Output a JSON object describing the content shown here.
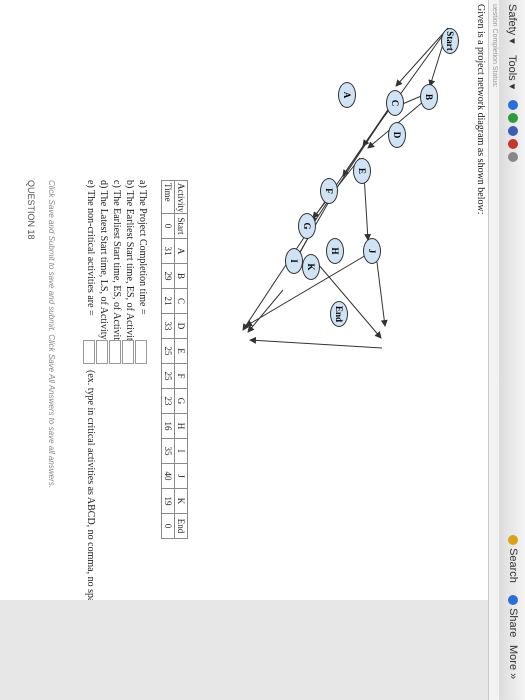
{
  "toolbar": {
    "safety": "Safety ▾",
    "tools": "Tools ▾",
    "search": "Search",
    "share": "Share",
    "more": "More »"
  },
  "status_strip": "uestion Completion Status:",
  "intro": "Given is a project network diagram as shown below:",
  "nodes": [
    "Start",
    "A",
    "B",
    "C",
    "D",
    "E",
    "F",
    "G",
    "I",
    "H",
    "K",
    "J",
    "End"
  ],
  "table": {
    "activity_label": "Activity",
    "time_label": "Time",
    "activities": [
      "Start",
      "A",
      "B",
      "C",
      "D",
      "E",
      "F",
      "G",
      "H",
      "I",
      "J",
      "K",
      "End"
    ],
    "times": [
      "0",
      "31",
      "29",
      "21",
      "33",
      "25",
      "25",
      "23",
      "16",
      "35",
      "40",
      "19",
      "0"
    ]
  },
  "questions": {
    "a": "a) The Project Completion time =",
    "b": "b) The Earliest Start time, ES, of Activity F =",
    "c": "c) The Earliest Start time, ES, of Activity K =",
    "d": "d) The Latest Start time, LS, of Activity E =",
    "e": "e) The non-critical activities are =",
    "e_hint": "(ex. type in critical activities as ABCD, no comma, no space)"
  },
  "footer": {
    "hint": "Click Save and Submit to save and submit. Click Save All Answers to save all answers.",
    "next": "QUESTION 18"
  },
  "colors": {
    "node_fill": "#cfe3f4",
    "toolbar": "#e9e9e9",
    "page": "#ffffff"
  }
}
